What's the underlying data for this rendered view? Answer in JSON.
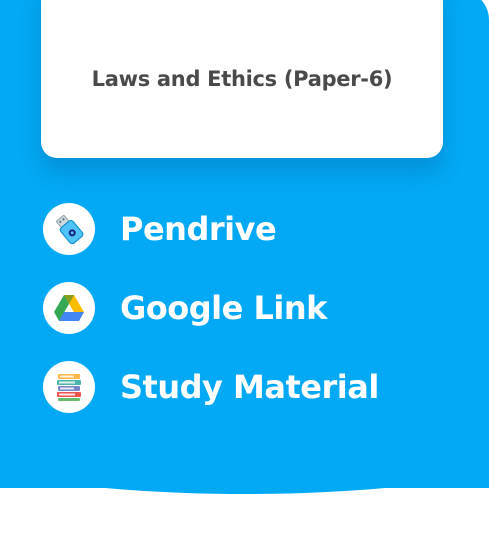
{
  "card": {
    "title": "Laws and Ethics (Paper-6)"
  },
  "options": [
    {
      "label": "Pendrive",
      "icon": "usb-pendrive-icon"
    },
    {
      "label": "Google Link",
      "icon": "google-drive-icon"
    },
    {
      "label": "Study Material",
      "icon": "books-stack-icon"
    }
  ],
  "colors": {
    "panel_background": "#03a9f4",
    "card_background": "#ffffff",
    "title_text": "#4a4a4a",
    "label_text": "#ffffff"
  }
}
